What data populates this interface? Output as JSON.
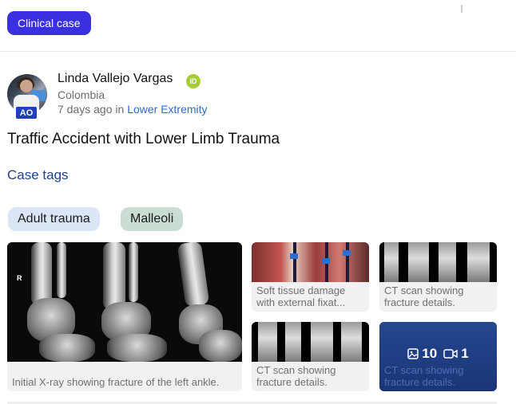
{
  "badge": {
    "label": "Clinical case"
  },
  "author": {
    "name": "Linda Vallejo Vargas",
    "country": "Colombia",
    "avatar_tag": "AO",
    "orcid_label": "iD",
    "posted_ago": "7 days ago",
    "posted_in_word": "in",
    "category": "Lower Extremity"
  },
  "case": {
    "title": "Traffic Accident with Lower Limb Trauma",
    "tags_heading": "Case tags",
    "tags": [
      "Adult trauma",
      "Malleoli"
    ]
  },
  "gallery": {
    "main_image": {
      "marker": "R",
      "caption": "Initial X-ray showing fracture of the left ankle."
    },
    "thumbnails": [
      {
        "caption": "Soft tissue damage with external fixat..."
      },
      {
        "caption": "CT scan showing fracture details."
      },
      {
        "caption": "CT scan showing fracture details."
      },
      {
        "caption": "CT scan showing fracture details."
      }
    ],
    "counts": {
      "images": "10",
      "videos": "1"
    }
  },
  "icons": {
    "image_count": "image-icon",
    "video_count": "video-icon",
    "orcid": "orcid-icon"
  },
  "colors": {
    "badge_bg": "#3a30e0",
    "link": "#2f6bd0",
    "tags_heading": "#1f3f8f",
    "tag_adult_bg": "#dbe5f5",
    "tag_malleoli_bg": "#c9ddd3",
    "more_overlay": "#1e3e8a"
  }
}
